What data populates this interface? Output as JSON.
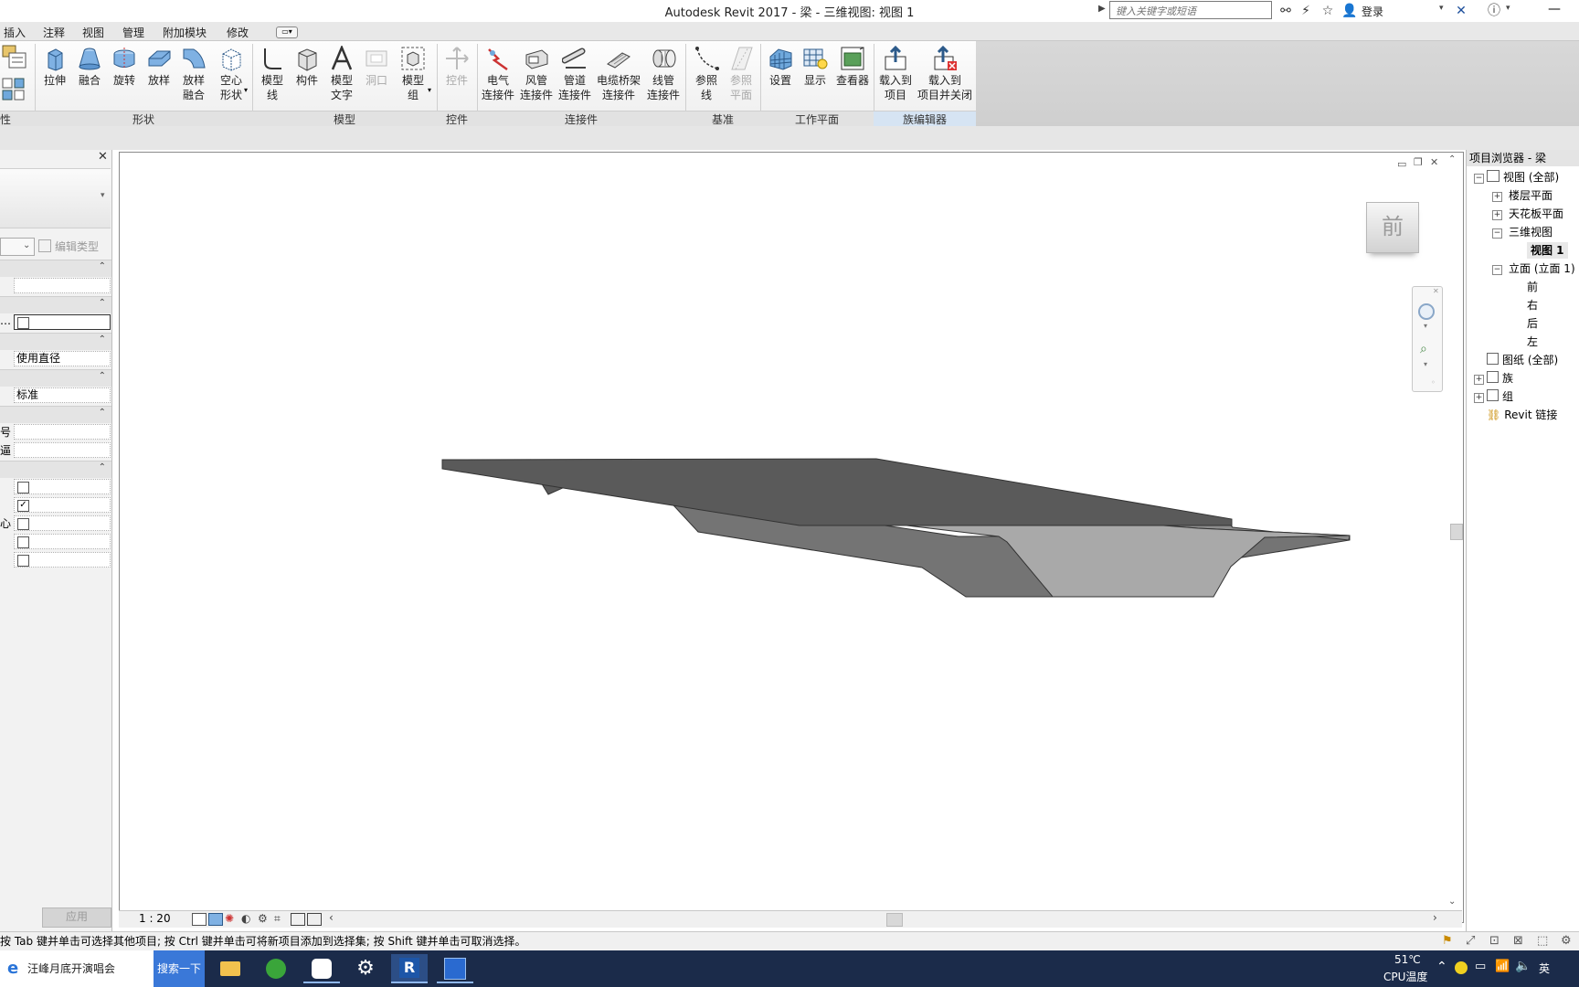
{
  "window": {
    "title": "Autodesk Revit 2017 -      梁 - 三维视图: 视图 1",
    "help_search_placeholder": "键入关键字或短语",
    "login_label": "登录"
  },
  "menu": [
    "插入",
    "注释",
    "视图",
    "管理",
    "附加模块",
    "修改"
  ],
  "ribbon": {
    "shape_buttons": [
      {
        "line1": "拉伸",
        "line2": ""
      },
      {
        "line1": "融合",
        "line2": ""
      },
      {
        "line1": "旋转",
        "line2": ""
      },
      {
        "line1": "放样",
        "line2": ""
      },
      {
        "line1": "放样",
        "line2": "融合"
      },
      {
        "line1": "空心",
        "line2": "形状"
      }
    ],
    "model_buttons": [
      {
        "line1": "模型",
        "line2": "线"
      },
      {
        "line1": "构件",
        "line2": ""
      },
      {
        "line1": "模型",
        "line2": "文字"
      },
      {
        "line1": "洞口",
        "line2": ""
      },
      {
        "line1": "模型",
        "line2": "组"
      }
    ],
    "control_buttons": [
      {
        "line1": "控件",
        "line2": ""
      }
    ],
    "connector_buttons": [
      {
        "line1": "电气",
        "line2": "连接件"
      },
      {
        "line1": "风管",
        "line2": "连接件"
      },
      {
        "line1": "管道",
        "line2": "连接件"
      },
      {
        "line1": "电缆桥架",
        "line2": "连接件"
      },
      {
        "line1": "线管",
        "line2": "连接件"
      }
    ],
    "datum_buttons": [
      {
        "line1": "参照",
        "line2": "线"
      },
      {
        "line1": "参照",
        "line2": "平面"
      }
    ],
    "workplane_buttons": [
      {
        "line1": "设置",
        "line2": ""
      },
      {
        "line1": "显示",
        "line2": ""
      },
      {
        "line1": "查看器",
        "line2": ""
      }
    ],
    "family_editor_buttons": [
      {
        "line1": "载入到",
        "line2": "项目"
      },
      {
        "line1": "载入到",
        "line2": "项目并关闭"
      }
    ],
    "panels": {
      "prop": "性",
      "shape": "形状",
      "model": "模型",
      "control": "控件",
      "connector": "连接件",
      "datum": "基准",
      "workplane": "工作平面",
      "family_editor": "族编辑器"
    }
  },
  "properties": {
    "edit_type_label": "编辑类型",
    "value_use_diameter": "使用直径",
    "value_standard": "标准",
    "cut_label_1": "…",
    "cut_label_2": "号",
    "cut_label_3": "逼",
    "cut_label_4": "心",
    "apply_label": "应用"
  },
  "viewcube": {
    "face_label": "前"
  },
  "view_controls": {
    "scale": "1 : 20"
  },
  "browser": {
    "title": "项目浏览器 - 梁",
    "items": [
      "视图 (全部)",
      "楼层平面",
      "天花板平面",
      "三维视图",
      "视图 1",
      "立面 (立面 1)",
      "前",
      "右",
      "后",
      "左",
      "图纸 (全部)",
      "族",
      "组",
      "Revit 链接"
    ]
  },
  "status": {
    "message": "按 Tab 键并单击可选择其他项目; 按 Ctrl 键并单击可将新项目添加到选择集; 按 Shift 键并单击可取消选择。"
  },
  "taskbar": {
    "search_text": "汪峰月底开演唱会",
    "search_button": "搜索一下",
    "temperature": "51℃",
    "cpu_label": "CPU温度",
    "ime": "英"
  },
  "colors": {
    "model_top": "#5a5a5a",
    "model_side_dark": "#6e6e6e",
    "model_side_light": "#a9a9a9",
    "taskbar": "#1b2b4a",
    "accent": "#3a78d8"
  }
}
